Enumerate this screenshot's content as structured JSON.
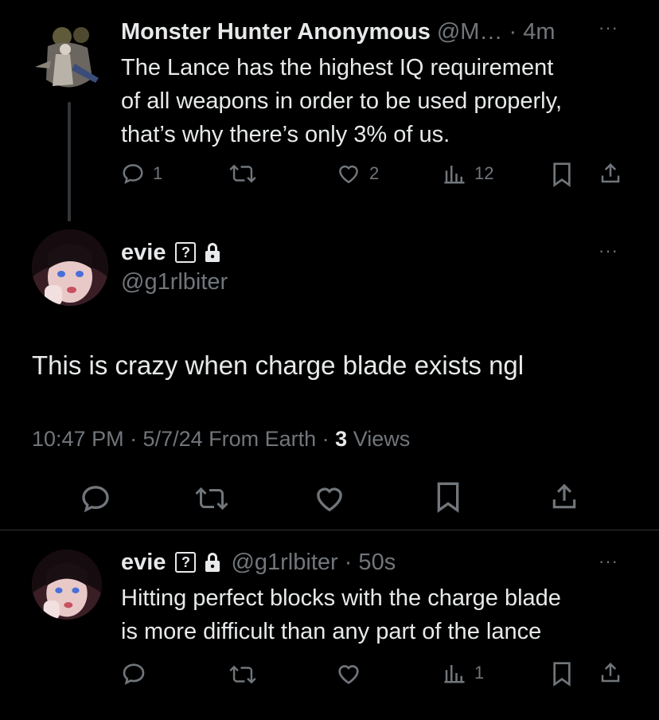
{
  "tweet1": {
    "author": "Monster Hunter Anonymous",
    "handle_time": "@M… · 4m",
    "more": "···",
    "text_lines": [
      "The Lance has the highest IQ requirement",
      "of all weapons in order to be used properly,",
      "that’s why there’s only 3% of us."
    ],
    "actions": {
      "replies": "1",
      "likes": "2",
      "views": "12"
    }
  },
  "main_tweet": {
    "author": "evie",
    "badge": "?",
    "handle": "@g1rlbiter",
    "more": "···",
    "text": "This is crazy when charge blade exists ngl",
    "meta_time": "10:47 PM · 5/7/24 From Earth · ",
    "meta_views_count": "3",
    "meta_views_label": " Views"
  },
  "reply": {
    "author": "evie",
    "badge": "?",
    "handle_time": "@g1rlbiter · 50s",
    "more": "···",
    "text_lines": [
      "Hitting perfect blocks with the charge blade",
      "is more difficult than any part of the lance"
    ],
    "actions": {
      "views": "1"
    }
  },
  "colors": {
    "background": "#000000",
    "text": "#e7e9ea",
    "muted": "#71767b",
    "divider": "#2f3336"
  }
}
